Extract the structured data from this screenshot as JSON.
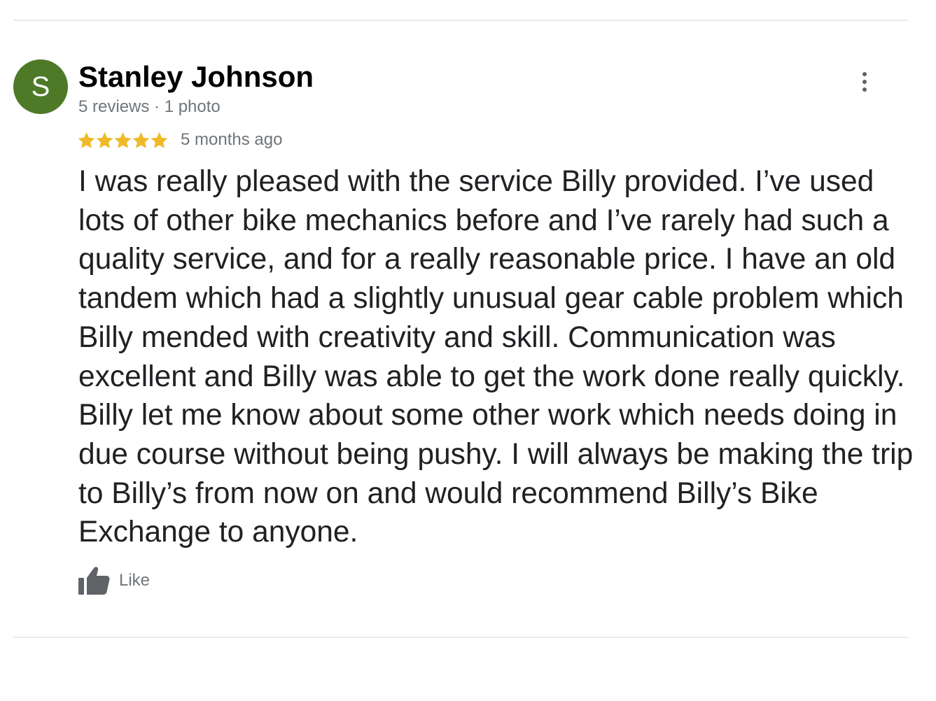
{
  "review": {
    "avatar_initial": "S",
    "reviewer_name": "Stanley Johnson",
    "reviewer_meta": "5 reviews · 1 photo",
    "rating": 5,
    "rating_max": 5,
    "date": "5 months ago",
    "text": "I was really pleased with the service Billy provided. I’ve used lots of other bike mechanics before and I’ve rarely had such a quality service, and for a really reasonable price. I have an old tandem which had a slightly unusual gear cable problem which Billy mended with creativity and skill. Communication was excellent and Billy was able to get the work done really quickly. Billy let me know about some other work which needs doing in due course without being pushy. I will always be making the trip to Billy’s from now on and would recommend Billy’s Bike Exchange to anyone.",
    "like_label": "Like"
  },
  "icons": {
    "more": "more-vert-icon",
    "star": "star-icon",
    "like": "thumb-up-icon"
  },
  "colors": {
    "avatar_bg": "#4e7a27",
    "star": "#f0b929",
    "secondary_text": "#70757a",
    "divider": "#e8eaed"
  }
}
